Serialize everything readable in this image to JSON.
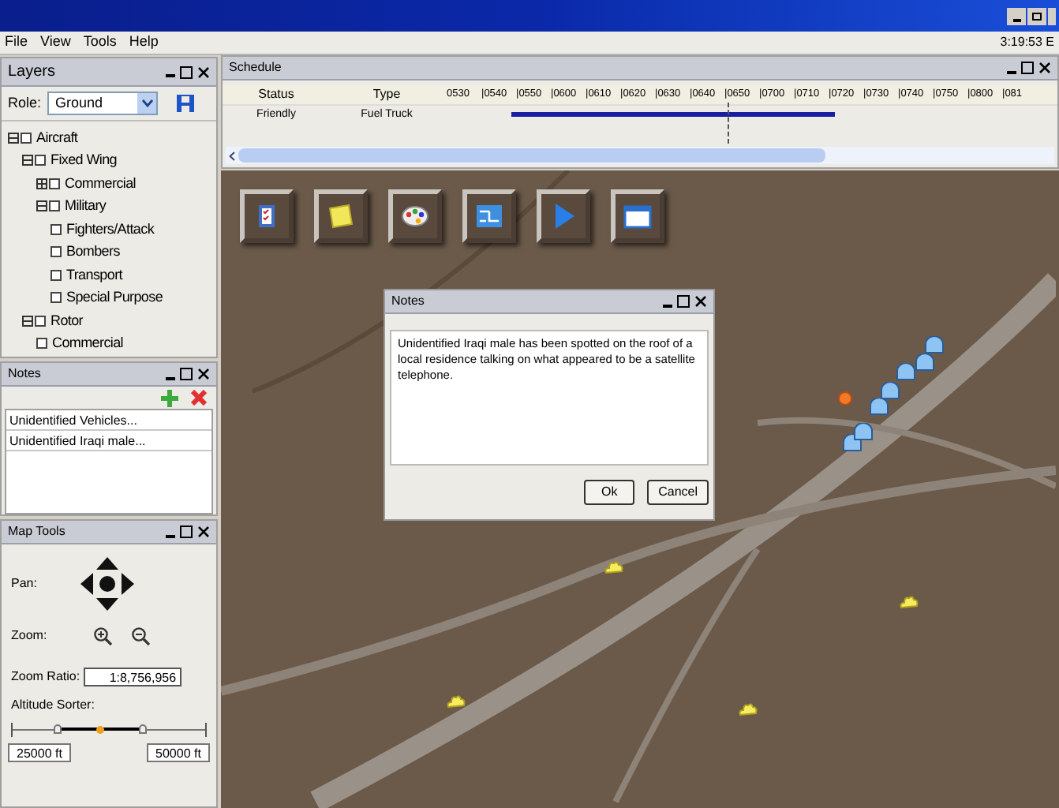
{
  "menu": [
    "File",
    "View",
    "Tools",
    "Help"
  ],
  "clock": "3:19:53 E",
  "layers": {
    "title": "Layers",
    "role_label": "Role:",
    "role": "Ground",
    "tree": [
      {
        "label": "Aircraft",
        "expanded": true,
        "checked": false,
        "children": [
          {
            "label": "Fixed Wing",
            "expanded": true,
            "checked": false,
            "children": [
              {
                "label": "Commercial",
                "expanded": false,
                "checked": false
              },
              {
                "label": "Military",
                "expanded": true,
                "checked": false,
                "children": [
                  {
                    "label": "Fighters/Attack",
                    "checked": false
                  },
                  {
                    "label": "Bombers",
                    "checked": false
                  },
                  {
                    "label": "Transport",
                    "checked": false
                  },
                  {
                    "label": "Special Purpose",
                    "checked": false
                  }
                ]
              }
            ]
          },
          {
            "label": "Rotor",
            "expanded": true,
            "checked": false,
            "children": [
              {
                "label": "Commercial",
                "checked": false
              }
            ]
          }
        ]
      }
    ]
  },
  "notes": {
    "title": "Notes",
    "items": [
      {
        "text": "Unidentified Vehicles...",
        "selected": false
      },
      {
        "text": "Unidentified Iraqi male...",
        "selected": false
      }
    ]
  },
  "map_tools": {
    "title": "Map Tools",
    "pan_label": "Pan:",
    "zoom_label": "Zoom:",
    "ratio_label": "Zoom Ratio:",
    "ratio": "1:8,756,956",
    "altitude_label": "Altitude Sorter:",
    "thumbs": [
      {
        "level": 0.23
      },
      {
        "level": 0.68
      }
    ],
    "min": "25000 ft",
    "max": "50000 ft"
  },
  "schedule": {
    "title": "Schedule",
    "columns": [
      "Status",
      "Type"
    ],
    "ticks": [
      "0530",
      "|0540",
      "|0550",
      "|0600",
      "|0610",
      "|0620",
      "|0630",
      "|0640",
      "|0650",
      "|0700",
      "|0710",
      "|0720",
      "|0730",
      "|0740",
      "|0750",
      "|0800",
      "|081"
    ],
    "rows": [
      {
        "status": "Friendly",
        "type": "Fuel Truck"
      }
    ]
  },
  "dialog": {
    "title": "Notes",
    "text": "Unidentified Iraqi male has been spotted on the roof of a local residence talking on what appeared to be a satellite telephone.",
    "buttons": [
      "Ok",
      "Cancel"
    ]
  }
}
